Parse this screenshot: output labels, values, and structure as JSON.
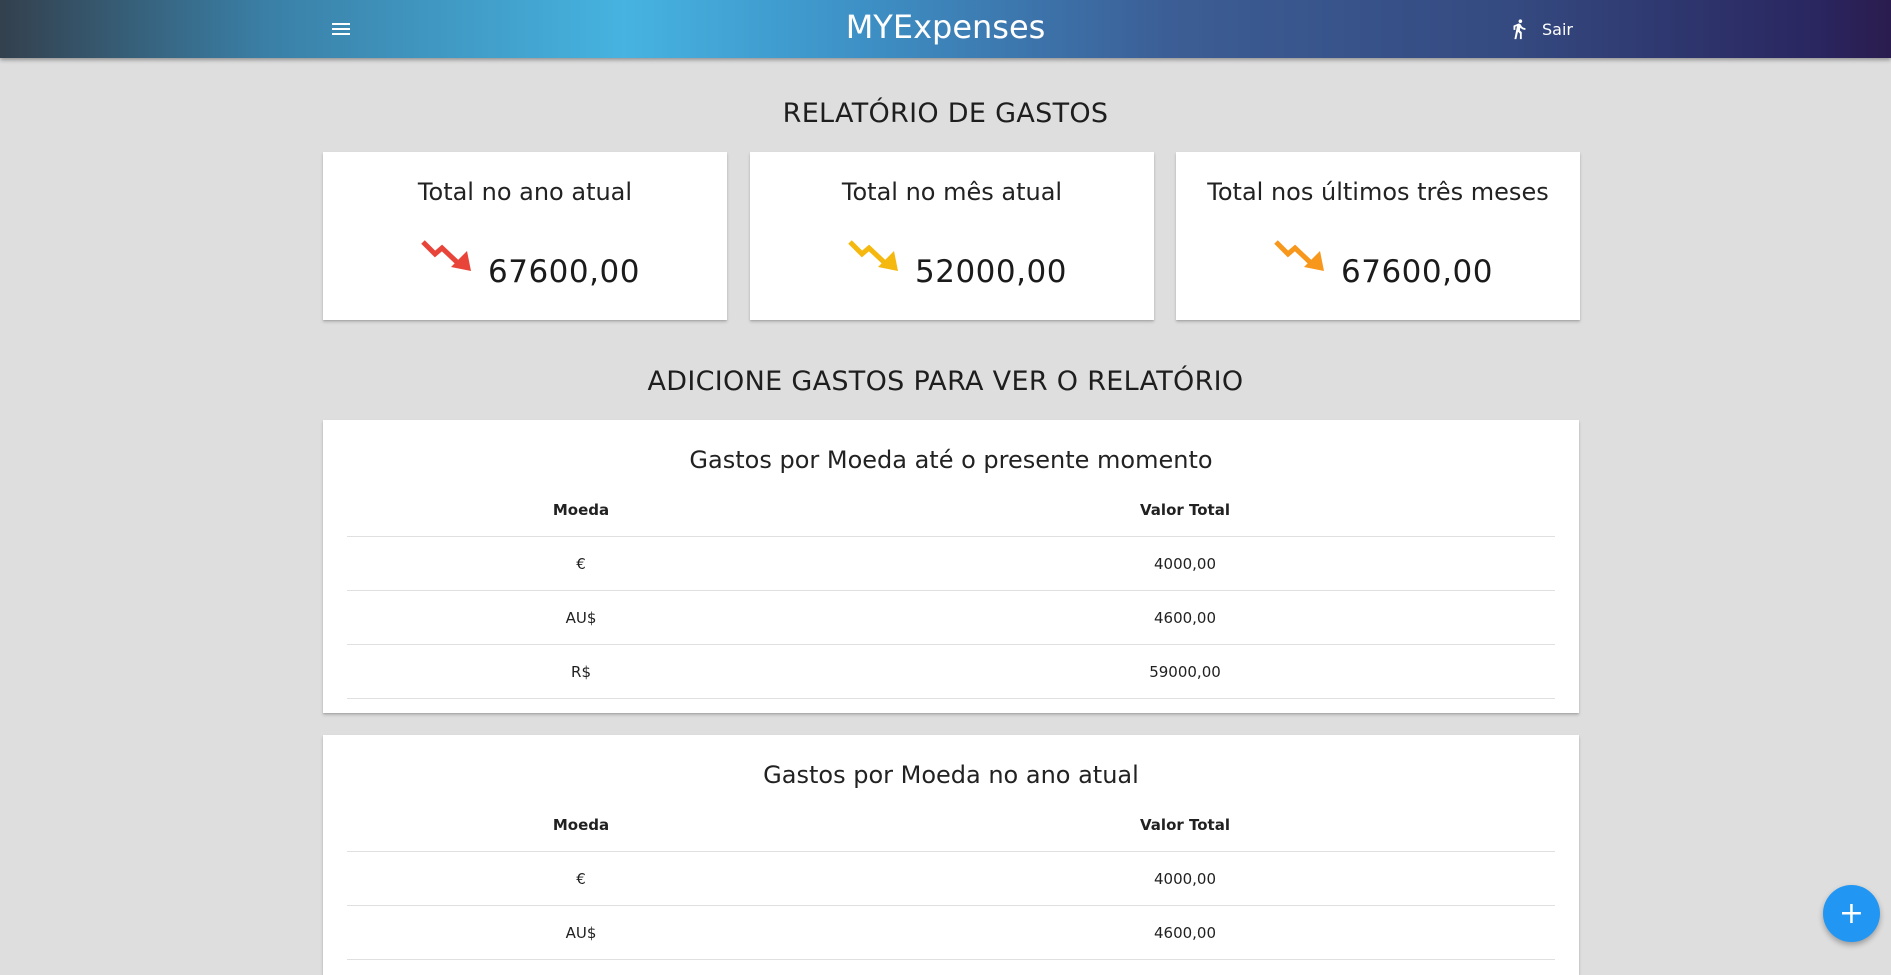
{
  "app": {
    "brand": "MYExpenses",
    "logout_label": "Sair",
    "menu_icon": "menu-icon",
    "logout_icon": "walking-person-icon"
  },
  "report": {
    "title": "RELATÓRIO DE GASTOS",
    "cards": [
      {
        "title": "Total no ano atual",
        "value": "67600,00",
        "icon": "trending-down-icon",
        "color": "#e8443a"
      },
      {
        "title": "Total no mês atual",
        "value": "52000,00",
        "icon": "trending-down-icon",
        "color": "#f5b80f"
      },
      {
        "title": "Total nos últimos três meses",
        "value": "67600,00",
        "icon": "trending-down-icon",
        "color": "#f7971b"
      }
    ]
  },
  "prompt": {
    "title": "ADICIONE GASTOS PARA VER O RELATÓRIO"
  },
  "tables": [
    {
      "title": "Gastos por Moeda até o presente momento",
      "headers": [
        "Moeda",
        "Valor Total"
      ],
      "rows": [
        [
          "€",
          "4000,00"
        ],
        [
          "AU$",
          "4600,00"
        ],
        [
          "R$",
          "59000,00"
        ]
      ]
    },
    {
      "title": "Gastos por Moeda no ano atual",
      "headers": [
        "Moeda",
        "Valor Total"
      ],
      "rows": [
        [
          "€",
          "4000,00"
        ],
        [
          "AU$",
          "4600,00"
        ]
      ]
    }
  ],
  "fab": {
    "label": "+",
    "icon": "plus-icon",
    "color": "#2196f3"
  }
}
